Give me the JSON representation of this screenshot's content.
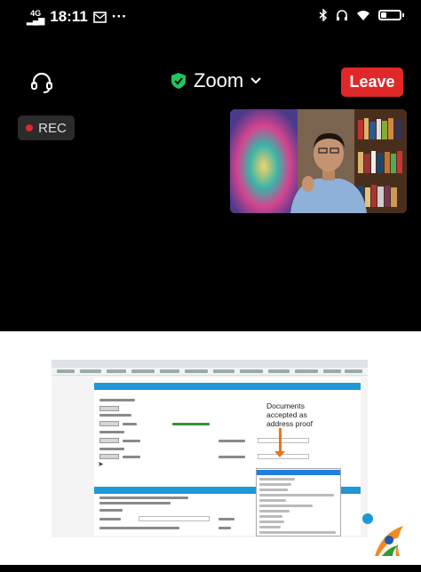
{
  "status_bar": {
    "network": "4G",
    "time": "18:11",
    "icons": [
      "mail-icon",
      "more-icon",
      "bluetooth-icon",
      "headphones-icon",
      "wifi-icon",
      "battery-icon"
    ],
    "battery_level": 0.3
  },
  "toolbar": {
    "title": "Zoom",
    "leave_label": "Leave",
    "icons": [
      "headset-icon",
      "shield-check-icon",
      "chevron-down-icon"
    ]
  },
  "recording": {
    "label": "REC"
  },
  "screen_share": {
    "annotation": "Documents accepted as address proof"
  },
  "colors": {
    "leave": "#e02828",
    "shield": "#22c55e",
    "form_header": "#1e98d7",
    "arrow": "#e6761c"
  }
}
